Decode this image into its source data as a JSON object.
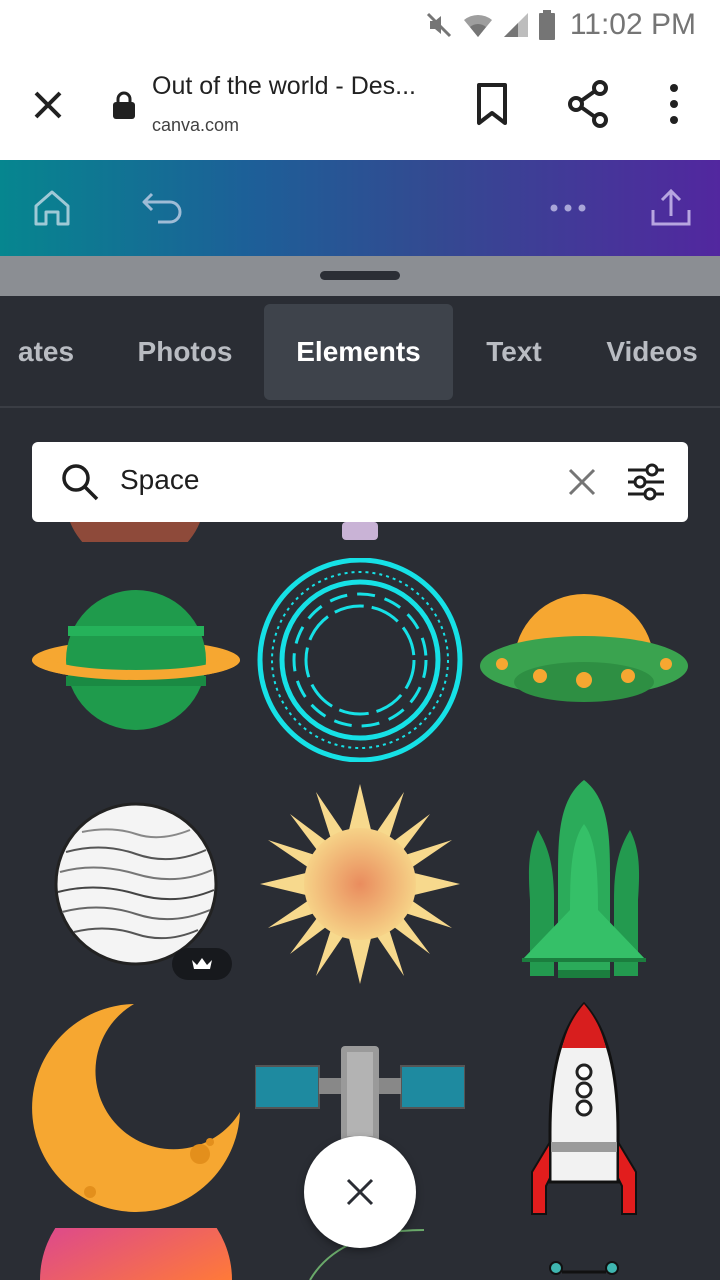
{
  "status_bar": {
    "time": "11:02 PM"
  },
  "browser": {
    "title": "Out of the world - Des...",
    "domain": "canva.com"
  },
  "tabs": [
    {
      "label": "ates"
    },
    {
      "label": "Photos"
    },
    {
      "label": "Elements",
      "active": true
    },
    {
      "label": "Text"
    },
    {
      "label": "Videos"
    }
  ],
  "search": {
    "value": "Space"
  },
  "elements": [
    {
      "name": "ringed-planet"
    },
    {
      "name": "cyan-portal-rings"
    },
    {
      "name": "ufo"
    },
    {
      "name": "sketched-planet",
      "premium": true
    },
    {
      "name": "sun"
    },
    {
      "name": "space-shuttle"
    },
    {
      "name": "crescent-moon"
    },
    {
      "name": "satellite"
    },
    {
      "name": "rocket"
    }
  ],
  "colors": {
    "panel_bg": "#2a2d34",
    "accent_gradient": [
      "#06868f",
      "#52279f"
    ]
  }
}
